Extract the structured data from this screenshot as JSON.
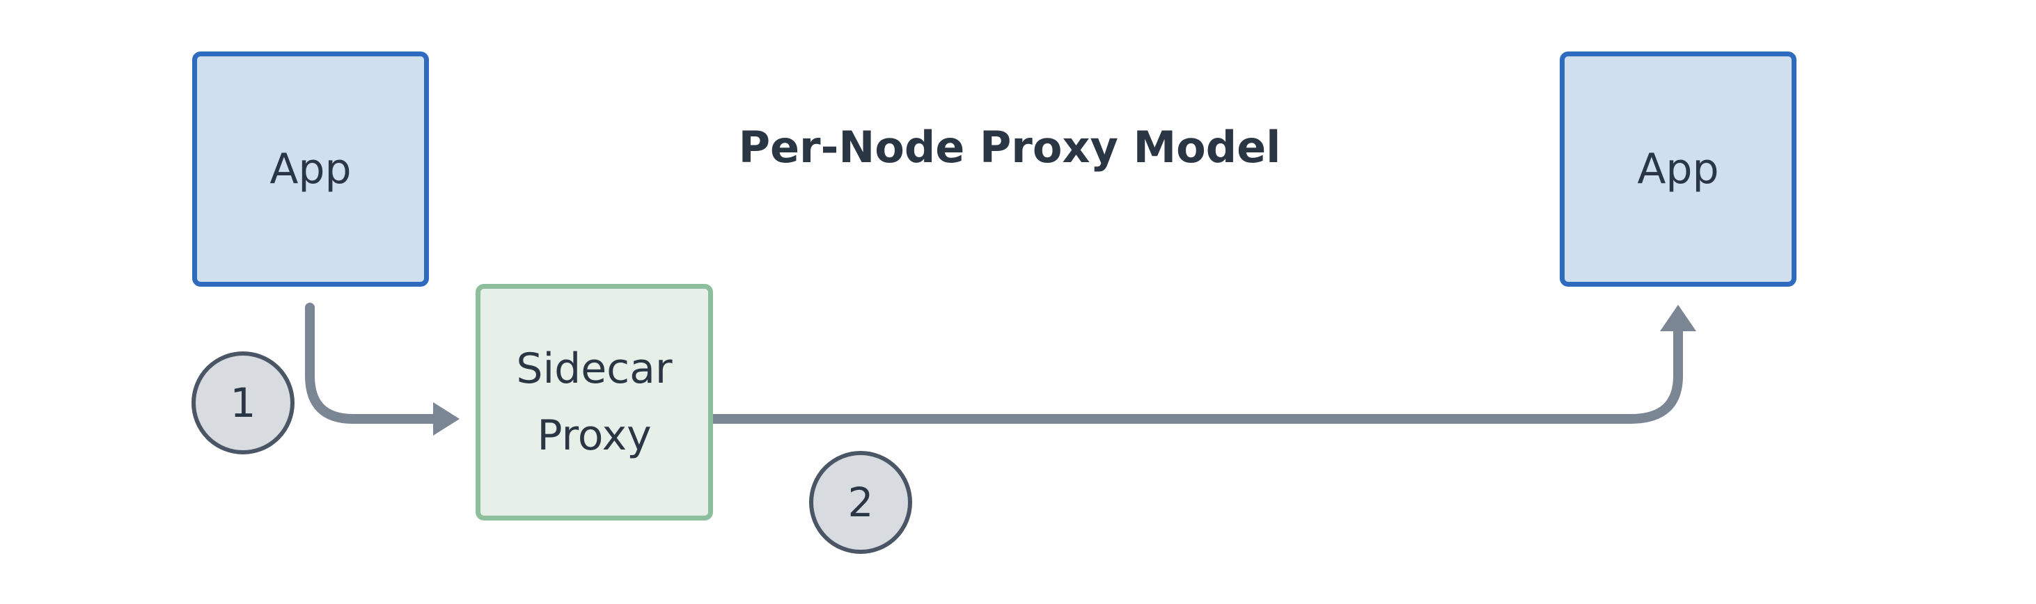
{
  "diagram": {
    "title": "Per-Node Proxy Model",
    "nodes": {
      "app_left": {
        "label": "App"
      },
      "sidecar_proxy": {
        "line1": "Sidecar",
        "line2": "Proxy"
      },
      "app_right": {
        "label": "App"
      }
    },
    "steps": {
      "step1": "1",
      "step2": "2"
    },
    "colors": {
      "app_fill": "#cfdfee",
      "app_border": "#2e6bbf",
      "proxy_fill": "#e6efe8",
      "proxy_border": "#8dbf9f",
      "connector": "#7b8694",
      "step_fill": "#d8dbe0",
      "step_border": "#4a5565",
      "text": "#2b3645"
    }
  }
}
